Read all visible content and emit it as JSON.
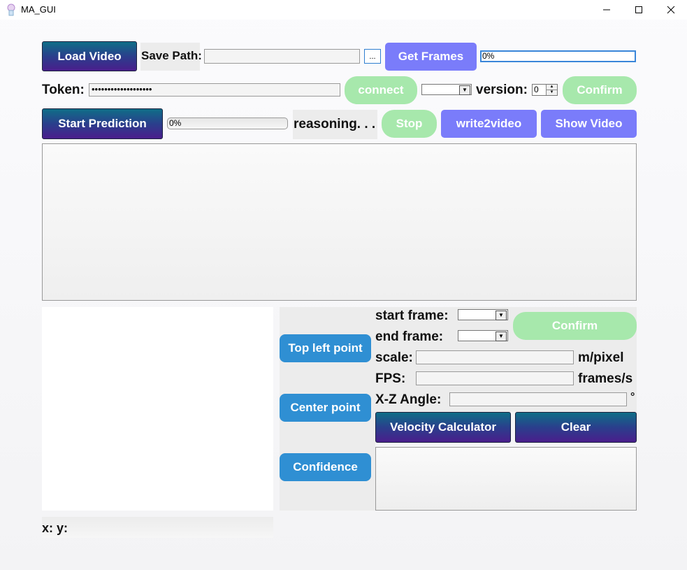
{
  "window": {
    "title": "MA_GUI"
  },
  "toolbar": {
    "load_video": "Load Video",
    "save_path_label": "Save Path:",
    "save_path_value": "",
    "browse": "...",
    "get_frames": "Get Frames",
    "frames_progress": "0%",
    "frames_progress_value": 0
  },
  "token_row": {
    "token_label": "Token:",
    "token_value": "•••••••••••••••••••",
    "connect": "connect",
    "version_label": "version:",
    "version_value": "0",
    "confirm": "Confirm"
  },
  "prediction_row": {
    "start_prediction": "Start Prediction",
    "progress": "0%",
    "progress_value": 0,
    "status": "reasoning. . .",
    "stop": "Stop",
    "write2video": "write2video",
    "show_video": "Show Video"
  },
  "points": {
    "top_left": "Top left point",
    "center": "Center point",
    "confidence": "Confidence"
  },
  "calc": {
    "start_frame_label": "start frame:",
    "end_frame_label": "end frame:",
    "confirm": "Confirm",
    "scale_label": "scale:",
    "scale_unit": "m/pixel",
    "fps_label": "FPS:",
    "fps_unit": "frames/s",
    "angle_label": "X-Z Angle:",
    "angle_unit": "°",
    "velocity_calculator": "Velocity Calculator",
    "clear": "Clear"
  },
  "coords": {
    "text": "x: y:"
  },
  "icons": {
    "app": "app-icon",
    "minimize": "minimize-icon",
    "maximize": "maximize-icon",
    "close": "close-icon",
    "dropdown": "chevron-down-icon",
    "spin_up": "spin-up-icon",
    "spin_down": "spin-down-icon"
  },
  "colors": {
    "accent_purple": "#7a7cfa",
    "accent_green": "#a7e8ac",
    "accent_blue": "#2f8fd3",
    "dark_gradient_start": "#0f6e87",
    "dark_gradient_end": "#4a1e8c"
  }
}
